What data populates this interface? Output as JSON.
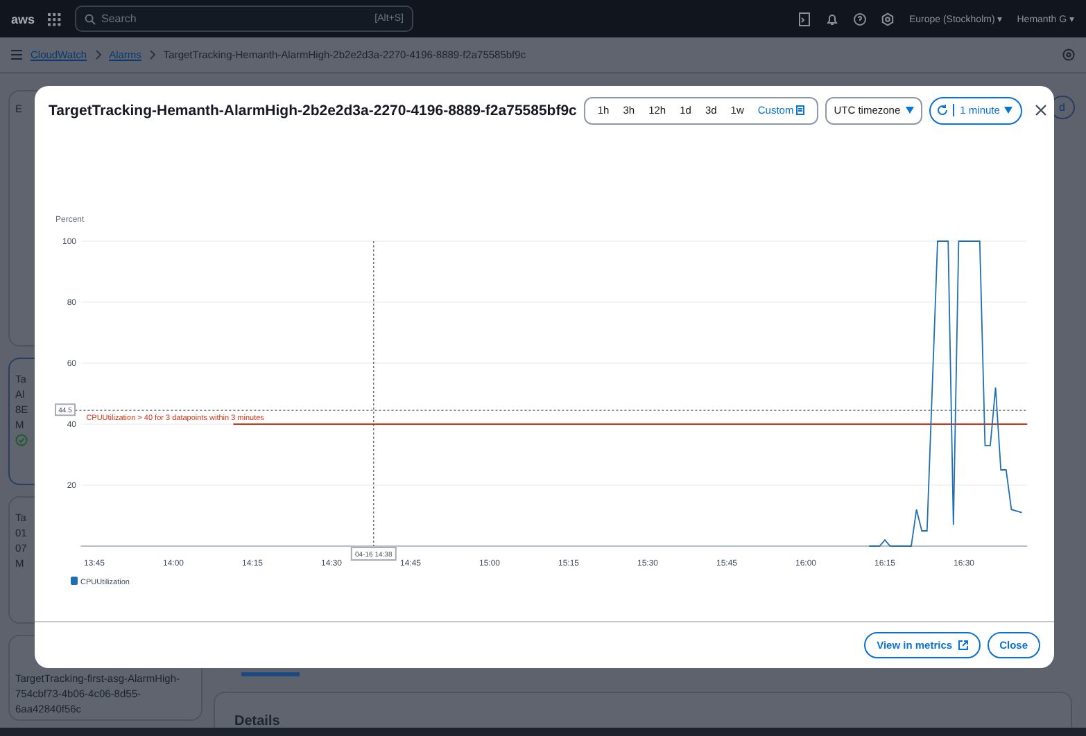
{
  "top_bar": {
    "logo": "aws",
    "search": {
      "placeholder": "Search"
    },
    "shortcut": "[Alt+S]",
    "region": "Europe (Stockholm) ▾",
    "user": "Hemanth G ▾"
  },
  "breadcrumb": [
    {
      "label": "CloudWatch",
      "link": true
    },
    {
      "label": "Alarms",
      "link": true
    },
    {
      "label": "TargetTracking-Hemanth-AlarmHigh-2b2e2d3a-2270-4196-8889-f2a75585bf9c",
      "link": false
    }
  ],
  "background": {
    "panel_heading": "E",
    "alarm_cards": [
      {
        "lines": [
          "Ta",
          "Al",
          "8E"
        ],
        "label": "M",
        "ok": true,
        "selected": true
      },
      {
        "lines": [
          "Ta",
          "01",
          "07"
        ],
        "label": "M",
        "ok": false,
        "selected": false
      }
    ],
    "last_card": {
      "lines": [
        "TargetTracking-first-asg-AlarmHigh-",
        "754cbf73-4b06-4c06-8d55-",
        "6aa42840f56c"
      ]
    },
    "right_button": "d",
    "details_heading": "Details"
  },
  "modal": {
    "title": "TargetTracking-Hemanth-AlarmHigh-2b2e2d3a-2270-4196-8889-f2a75585bf9c",
    "ranges": [
      {
        "label": "1h",
        "selected": false
      },
      {
        "label": "3h",
        "selected": false
      },
      {
        "label": "12h",
        "selected": false
      },
      {
        "label": "1d",
        "selected": false
      },
      {
        "label": "3d",
        "selected": false
      },
      {
        "label": "1w",
        "selected": false
      },
      {
        "label": "Custom",
        "selected": true
      }
    ],
    "timezone": "UTC timezone",
    "refresh_interval": "1 minute",
    "chart_data": {
      "type": "line",
      "ylabel": "Percent",
      "grid": true,
      "xlim": [
        13.707,
        16.7
      ],
      "ylim": [
        0,
        100
      ],
      "yticks": [
        20,
        40,
        60,
        80,
        100
      ],
      "xticks": [
        {
          "value": 13.75,
          "label": "13:45"
        },
        {
          "value": 14,
          "label": "14:00"
        },
        {
          "value": 14.25,
          "label": "14:15"
        },
        {
          "value": 14.5,
          "label": "14:30"
        },
        {
          "value": 14.75,
          "label": "14:45"
        },
        {
          "value": 15,
          "label": "15:00"
        },
        {
          "value": 15.25,
          "label": "15:15"
        },
        {
          "value": 15.5,
          "label": "15:30"
        },
        {
          "value": 15.75,
          "label": "15:45"
        },
        {
          "value": 16,
          "label": "16:00"
        },
        {
          "value": 16.25,
          "label": "16:15"
        },
        {
          "value": 16.5,
          "label": "16:30"
        }
      ],
      "x": [
        16.2,
        16.2167,
        16.2333,
        16.25,
        16.2667,
        16.3333,
        16.35,
        16.3667,
        16.3833,
        16.4167,
        16.45,
        16.4667,
        16.4833,
        16.55,
        16.5667,
        16.5833,
        16.6,
        16.6167,
        16.6333,
        16.65,
        16.6833
      ],
      "series": [
        {
          "name": "CPUUtilization",
          "color": "#1f6fb5",
          "values": [
            0,
            0,
            0,
            2,
            0,
            0,
            12,
            5,
            5,
            100,
            100,
            7,
            100,
            100,
            33,
            33,
            52,
            25,
            25,
            12,
            11
          ]
        }
      ],
      "ref_lines": [
        {
          "axis": "y",
          "value": 40,
          "label": "CPUUtilization > 40 for 3 datapoints within 3 minutes",
          "color": "#d13212"
        },
        {
          "axis": "y",
          "value": 44.5,
          "label": "44.5",
          "color": "#555555"
        },
        {
          "axis": "x",
          "value": 14.6333,
          "color": "#555555"
        }
      ]
    },
    "crosshair_time": "04-16 14:38",
    "buttons": [
      {
        "label": "View in metrics",
        "kind": "external"
      },
      {
        "label": "Close",
        "kind": "plain"
      }
    ]
  }
}
